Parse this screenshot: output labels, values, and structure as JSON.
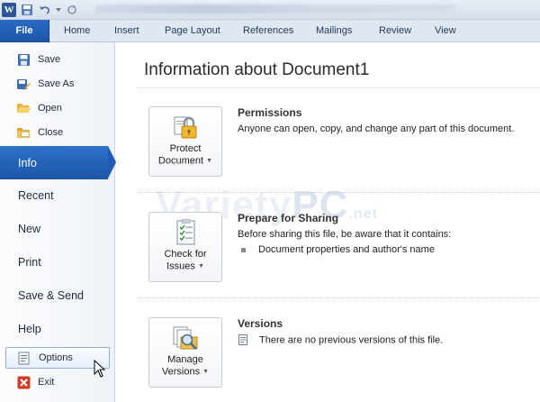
{
  "tabs": [
    {
      "label": "File"
    },
    {
      "label": "Home"
    },
    {
      "label": "Insert"
    },
    {
      "label": "Page Layout"
    },
    {
      "label": "References"
    },
    {
      "label": "Mailings"
    },
    {
      "label": "Review"
    },
    {
      "label": "View"
    }
  ],
  "nav": {
    "save": "Save",
    "save_as": "Save As",
    "open": "Open",
    "close": "Close",
    "info": "Info",
    "recent": "Recent",
    "new": "New",
    "print": "Print",
    "save_send": "Save & Send",
    "help": "Help",
    "options": "Options",
    "exit": "Exit"
  },
  "main": {
    "heading": "Information about Document1",
    "permissions": {
      "button_line1": "Protect",
      "button_line2": "Document",
      "title": "Permissions",
      "desc": "Anyone can open, copy, and change any part of this document."
    },
    "sharing": {
      "button_line1": "Check for",
      "button_line2": "Issues",
      "title": "Prepare for Sharing",
      "desc": "Before sharing this file, be aware that it contains:",
      "bullet": "Document properties and author's name"
    },
    "versions": {
      "button_line1": "Manage",
      "button_line2": "Versions",
      "title": "Versions",
      "desc": "There are no previous versions of this file."
    }
  },
  "watermark": {
    "variety": "Variety",
    "pc": "PC",
    "net": ".net"
  },
  "colors": {
    "accent": "#1f5bb0",
    "nav_active": "#2a6bc4"
  }
}
